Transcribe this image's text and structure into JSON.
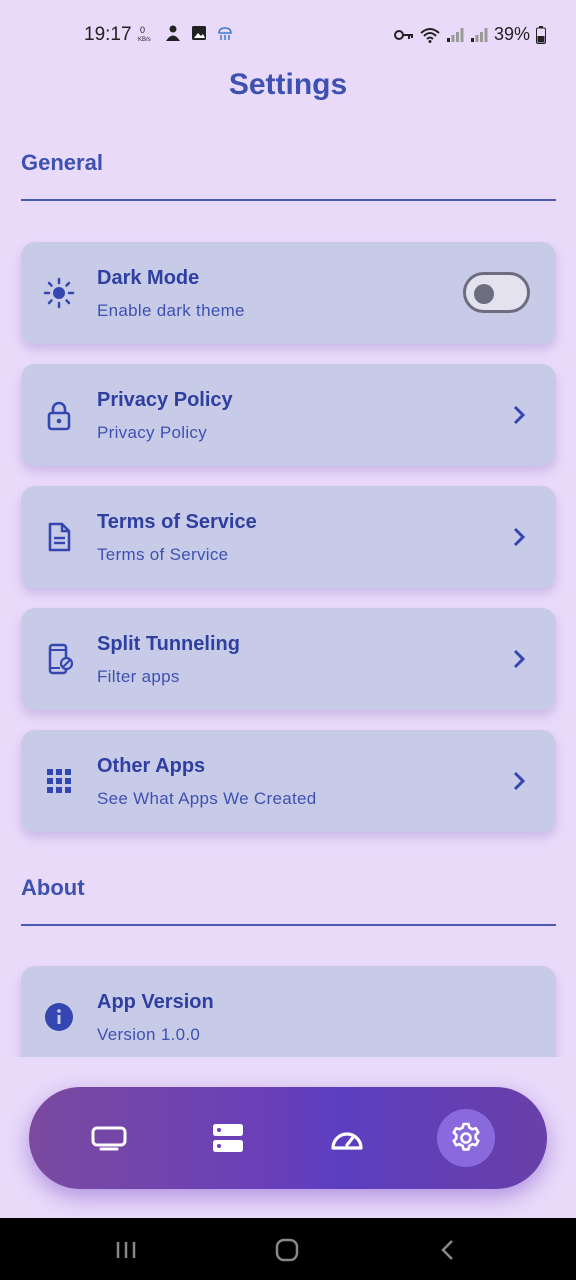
{
  "status_bar": {
    "time": "19:17",
    "battery": "39%"
  },
  "title": "Settings",
  "sections": {
    "general": {
      "title": "General"
    },
    "about": {
      "title": "About"
    }
  },
  "items": [
    {
      "title": "Dark Mode",
      "subtitle": "Enable dark theme",
      "icon": "sun-icon",
      "control": "toggle",
      "toggle_on": false
    },
    {
      "title": "Privacy Policy",
      "subtitle": "Privacy Policy",
      "icon": "lock-icon",
      "control": "chevron"
    },
    {
      "title": "Terms of Service",
      "subtitle": "Terms of Service",
      "icon": "document-icon",
      "control": "chevron"
    },
    {
      "title": "Split Tunneling",
      "subtitle": "Filter apps",
      "icon": "phone-filter-icon",
      "control": "chevron"
    },
    {
      "title": "Other Apps",
      "subtitle": "See What Apps We Created",
      "icon": "grid-icon",
      "control": "chevron"
    }
  ],
  "about_items": [
    {
      "title": "App Version",
      "subtitle": "Version 1.0.0",
      "icon": "info-icon"
    }
  ],
  "bottom_nav": {
    "items": [
      {
        "icon": "monitor-icon"
      },
      {
        "icon": "server-icon"
      },
      {
        "icon": "speedometer-icon"
      },
      {
        "icon": "gear-icon",
        "active": true
      }
    ]
  },
  "colors": {
    "background": "#e9dafa",
    "card": "#c8cbe8",
    "accent": "#3d51b0",
    "nav_gradient_start": "#7a4aa0",
    "nav_gradient_end": "#5c3fc0"
  }
}
